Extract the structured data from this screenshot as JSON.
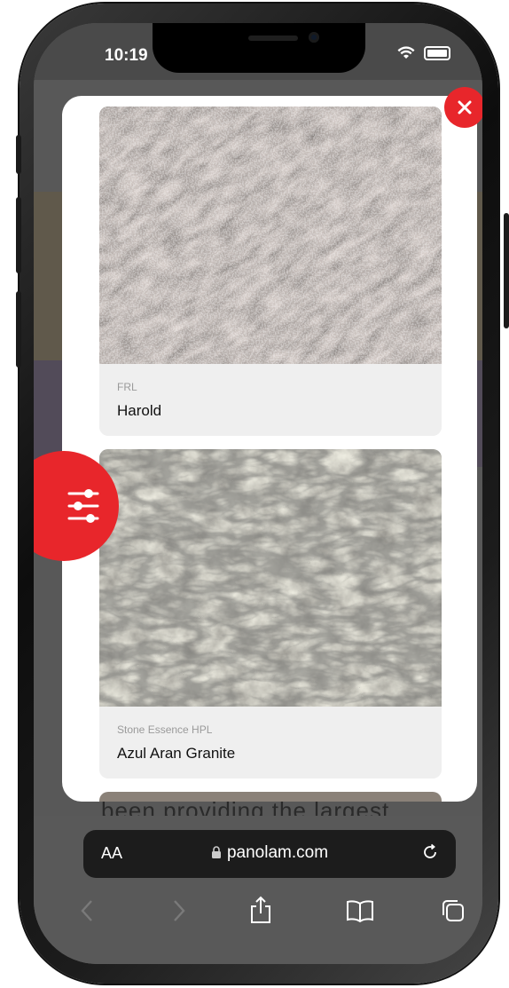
{
  "status_bar": {
    "time": "10:19"
  },
  "cards": [
    {
      "category": "FRL",
      "name": "Harold"
    },
    {
      "category": "Stone Essence HPL",
      "name": "Azul Aran Granite"
    }
  ],
  "background_text": "been providing the largest",
  "safari": {
    "text_size_label": "AA",
    "url": "panolam.com"
  },
  "colors": {
    "accent": "#e8262b",
    "card_bg": "#efefef"
  },
  "icons": [
    "close-icon",
    "filter-sliders-icon",
    "lock-icon",
    "reload-icon",
    "back-icon",
    "forward-icon",
    "share-icon",
    "bookmarks-icon",
    "tabs-icon",
    "wifi-icon",
    "battery-icon"
  ]
}
